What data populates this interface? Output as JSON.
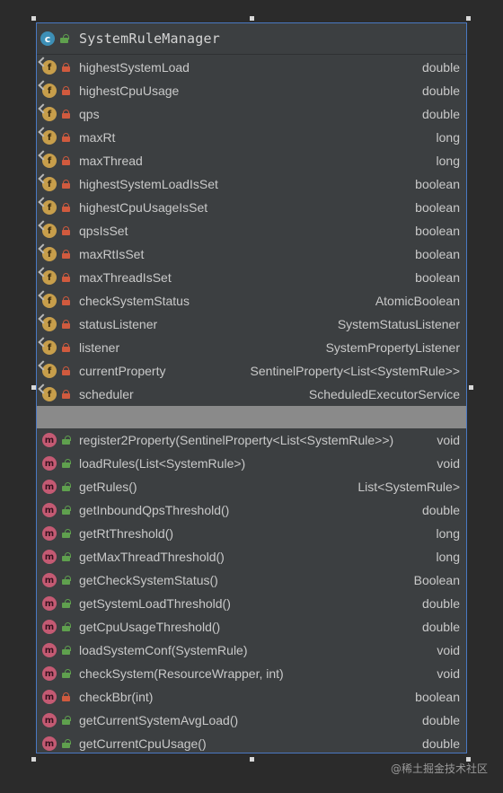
{
  "class": {
    "icon": "class-icon",
    "icon_letter": "c",
    "name": "SystemRuleManager"
  },
  "fields": [
    {
      "name": "highestSystemLoad",
      "type": "double",
      "static": true
    },
    {
      "name": "highestCpuUsage",
      "type": "double",
      "static": true
    },
    {
      "name": "qps",
      "type": "double",
      "static": true
    },
    {
      "name": "maxRt",
      "type": "long",
      "static": true
    },
    {
      "name": "maxThread",
      "type": "long",
      "static": true
    },
    {
      "name": "highestSystemLoadIsSet",
      "type": "boolean",
      "static": true
    },
    {
      "name": "highestCpuUsageIsSet",
      "type": "boolean",
      "static": true
    },
    {
      "name": "qpsIsSet",
      "type": "boolean",
      "static": true
    },
    {
      "name": "maxRtIsSet",
      "type": "boolean",
      "static": true
    },
    {
      "name": "maxThreadIsSet",
      "type": "boolean",
      "static": true
    },
    {
      "name": "checkSystemStatus",
      "type": "AtomicBoolean",
      "static": true
    },
    {
      "name": "statusListener",
      "type": "SystemStatusListener",
      "static": true
    },
    {
      "name": "listener",
      "type": "SystemPropertyListener",
      "static": true
    },
    {
      "name": "currentProperty",
      "type": "SentinelProperty<List<SystemRule>>",
      "static": true
    },
    {
      "name": "scheduler",
      "type": "ScheduledExecutorService",
      "static": true
    }
  ],
  "methods": [
    {
      "name": "register2Property(SentinelProperty<List<SystemRule>>)",
      "type": "void",
      "access": "public"
    },
    {
      "name": "loadRules(List<SystemRule>)",
      "type": "void",
      "access": "public"
    },
    {
      "name": "getRules()",
      "type": "List<SystemRule>",
      "access": "public"
    },
    {
      "name": "getInboundQpsThreshold()",
      "type": "double",
      "access": "public"
    },
    {
      "name": "getRtThreshold()",
      "type": "long",
      "access": "public"
    },
    {
      "name": "getMaxThreadThreshold()",
      "type": "long",
      "access": "public"
    },
    {
      "name": "getCheckSystemStatus()",
      "type": "Boolean",
      "access": "public"
    },
    {
      "name": "getSystemLoadThreshold()",
      "type": "double",
      "access": "public"
    },
    {
      "name": "getCpuUsageThreshold()",
      "type": "double",
      "access": "public"
    },
    {
      "name": "loadSystemConf(SystemRule)",
      "type": "void",
      "access": "public"
    },
    {
      "name": "checkSystem(ResourceWrapper, int)",
      "type": "void",
      "access": "public"
    },
    {
      "name": "checkBbr(int)",
      "type": "boolean",
      "access": "private"
    },
    {
      "name": "getCurrentSystemAvgLoad()",
      "type": "double",
      "access": "public"
    },
    {
      "name": "getCurrentCpuUsage()",
      "type": "double",
      "access": "public"
    }
  ],
  "field_icon_letter": "f",
  "method_icon_letter": "m",
  "watermark": "@稀土掘金技术社区",
  "colors": {
    "background": "#2b2b2b",
    "panel": "#3c3f41",
    "selection_border": "#4a78c2",
    "separator": "#8a8a8a",
    "class_icon": "#3d8fb6",
    "field_icon": "#c79e4b",
    "method_icon": "#c45a73",
    "private_lock": "#d05a3e",
    "public_lock": "#5fa04e"
  }
}
